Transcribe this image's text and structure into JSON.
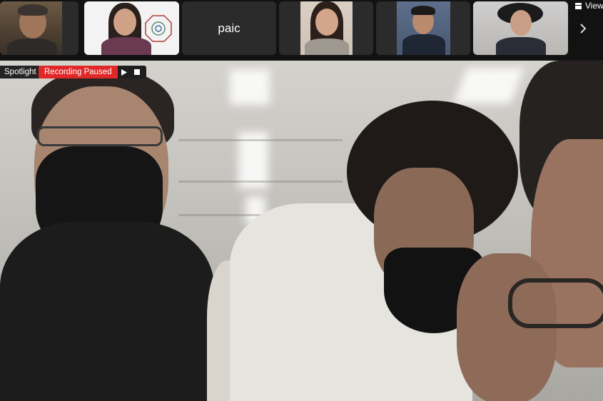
{
  "gallery": {
    "participants": [
      {
        "id": "p1",
        "name": "",
        "has_video": true
      },
      {
        "id": "p2",
        "name": "",
        "has_video": true
      },
      {
        "id": "p3",
        "name": "paic",
        "has_video": false
      },
      {
        "id": "p4",
        "name": "",
        "has_video": true
      },
      {
        "id": "p5",
        "name": "",
        "has_video": true
      },
      {
        "id": "p6",
        "name": "",
        "has_video": true
      }
    ],
    "next_icon": "chevron-right-icon"
  },
  "toolbar": {
    "view_label": "View",
    "view_icon": "grid-icon"
  },
  "spotlight": {
    "label": "Spotlight"
  },
  "recording": {
    "status_label": "Recording Paused",
    "status_color": "#e02828",
    "resume_icon": "play-icon",
    "stop_icon": "stop-icon"
  }
}
